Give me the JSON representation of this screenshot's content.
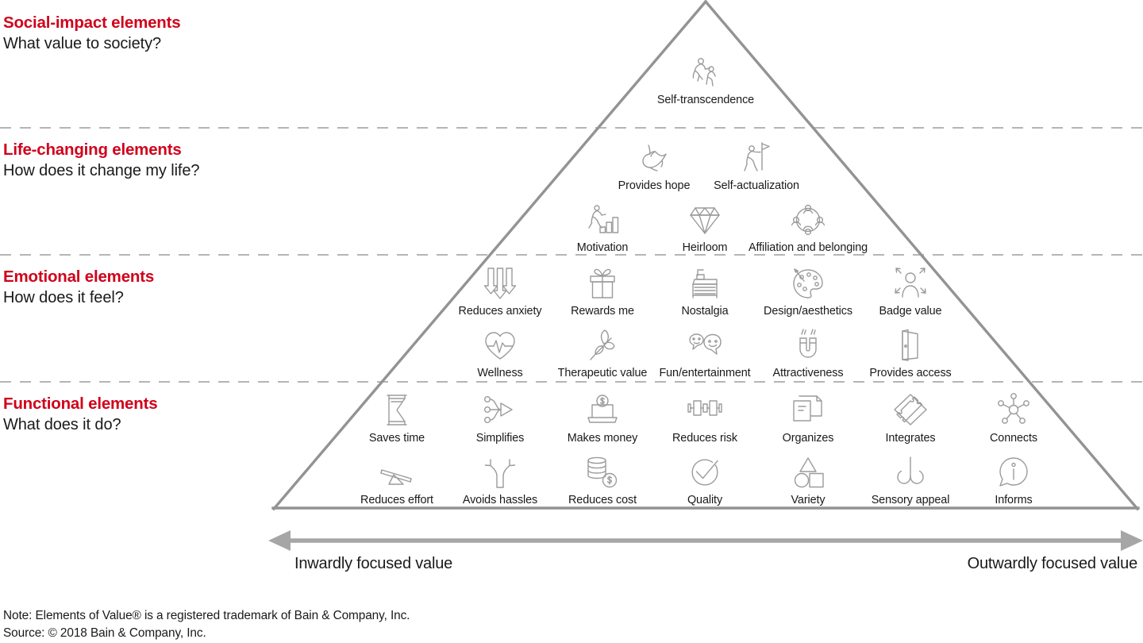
{
  "tiers": [
    {
      "id": "social-impact",
      "title": "Social-impact elements",
      "question": "What value to society?"
    },
    {
      "id": "life-changing",
      "title": "Life-changing elements",
      "question": "How does it change my life?"
    },
    {
      "id": "emotional",
      "title": "Emotional elements",
      "question": "How does it feel?"
    },
    {
      "id": "functional",
      "title": "Functional elements",
      "question": "What does it do?"
    }
  ],
  "elements": {
    "social_impact": [
      {
        "label": "Self-transcendence",
        "icon": "self-transcendence-icon"
      }
    ],
    "life_changing_row1": [
      {
        "label": "Provides hope",
        "icon": "dove-icon"
      },
      {
        "label": "Self-actualization",
        "icon": "flag-climber-icon"
      }
    ],
    "life_changing_row2": [
      {
        "label": "Motivation",
        "icon": "runner-steps-icon"
      },
      {
        "label": "Heirloom",
        "icon": "diamond-icon"
      },
      {
        "label": "Affiliation and belonging",
        "icon": "people-circle-icon"
      }
    ],
    "emotional_row1": [
      {
        "label": "Reduces anxiety",
        "icon": "down-arrows-icon"
      },
      {
        "label": "Rewards me",
        "icon": "gift-icon"
      },
      {
        "label": "Nostalgia",
        "icon": "film-projector-icon"
      },
      {
        "label": "Design/aesthetics",
        "icon": "palette-icon"
      },
      {
        "label": "Badge value",
        "icon": "badge-person-icon"
      }
    ],
    "emotional_row2": [
      {
        "label": "Wellness",
        "icon": "heart-pulse-icon"
      },
      {
        "label": "Therapeutic value",
        "icon": "leaf-icon"
      },
      {
        "label": "Fun/entertainment",
        "icon": "smiley-chat-icon"
      },
      {
        "label": "Attractiveness",
        "icon": "magnet-icon"
      },
      {
        "label": "Provides access",
        "icon": "open-door-icon"
      }
    ],
    "functional_row1": [
      {
        "label": "Saves time",
        "icon": "hourglass-icon"
      },
      {
        "label": "Simplifies",
        "icon": "converge-arrow-icon"
      },
      {
        "label": "Makes money",
        "icon": "laptop-dollar-icon"
      },
      {
        "label": "Reduces risk",
        "icon": "shock-absorber-icon"
      },
      {
        "label": "Organizes",
        "icon": "documents-icon"
      },
      {
        "label": "Integrates",
        "icon": "puzzle-diamond-icon"
      },
      {
        "label": "Connects",
        "icon": "network-node-icon"
      }
    ],
    "functional_row2": [
      {
        "label": "Reduces effort",
        "icon": "seesaw-icon"
      },
      {
        "label": "Avoids hassles",
        "icon": "fork-arrows-icon"
      },
      {
        "label": "Reduces cost",
        "icon": "coin-stacks-icon"
      },
      {
        "label": "Quality",
        "icon": "checkmark-circle-icon"
      },
      {
        "label": "Variety",
        "icon": "shapes-icon"
      },
      {
        "label": "Sensory appeal",
        "icon": "nose-scent-icon"
      },
      {
        "label": "Informs",
        "icon": "info-bubble-icon"
      }
    ]
  },
  "axis": {
    "left_caption": "Inwardly focused value",
    "right_caption": "Outwardly focused value"
  },
  "footer": {
    "note": "Note: Elements of Value® is a registered trademark of Bain & Company, Inc.",
    "source": "Source: © 2018 Bain & Company, Inc."
  },
  "colors": {
    "accent_red": "#d0021b",
    "text": "#1a1a1a",
    "line_gray": "#939393",
    "icon_gray": "#9b9b9b",
    "dash_gray": "#b5b5b5"
  }
}
